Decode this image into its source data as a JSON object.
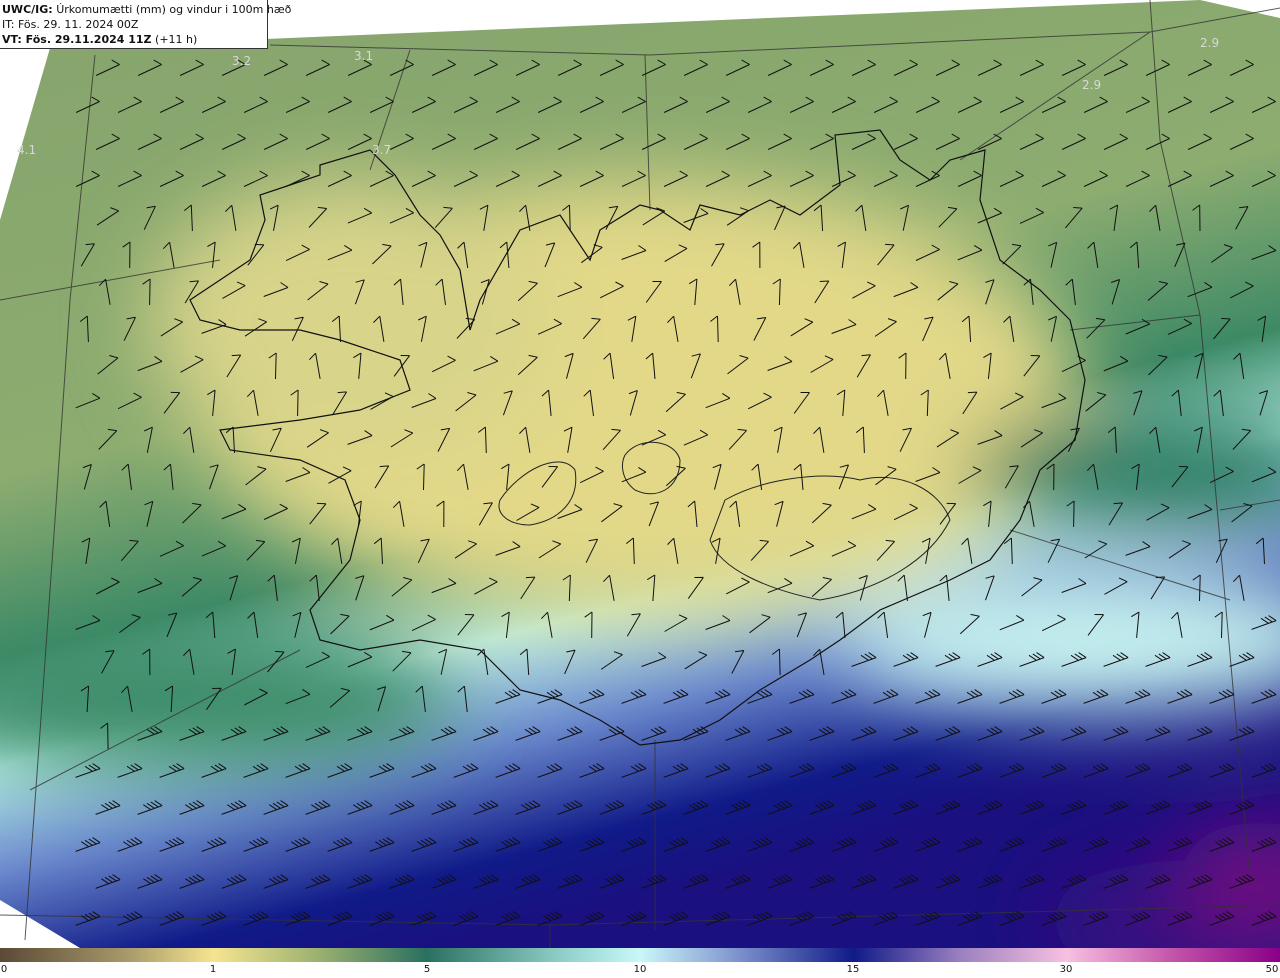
{
  "header": {
    "model": "UWC/IG:",
    "title": "Úrkomumætti (mm) og vindur i 100m hæð",
    "initial_time": "IT: Fös. 29. 11. 2024 00Z",
    "valid_label": "VT: Fös. 29.11.2024 11Z",
    "valid_offset": "(+11 h)"
  },
  "colorbar": {
    "ticks": [
      "0",
      "1",
      "5",
      "10",
      "15",
      "30",
      "50"
    ],
    "colors": [
      "#5a4a36",
      "#f5e590",
      "#2a7060",
      "#c8f8f8",
      "#101a88",
      "#f8c0e0",
      "#880088"
    ]
  },
  "pressure_labels": [
    "3.2",
    "3.1",
    "4.1",
    "3.7",
    "2.9",
    "2.9"
  ]
}
